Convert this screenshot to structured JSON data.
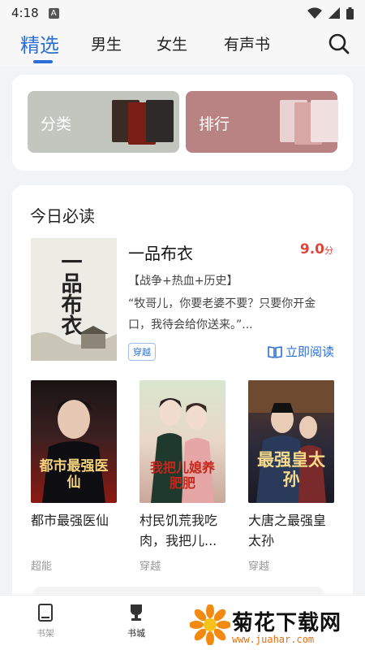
{
  "status": {
    "time": "4:18",
    "indicator": "A"
  },
  "tabs": [
    {
      "label": "精选",
      "active": true
    },
    {
      "label": "男生"
    },
    {
      "label": "女生"
    },
    {
      "label": "有声书"
    }
  ],
  "search_icon": "search-icon",
  "banners": [
    {
      "label": "分类",
      "color": "#c3c6bf"
    },
    {
      "label": "排行",
      "color": "#b88382"
    }
  ],
  "section": {
    "title": "今日必读"
  },
  "featured": {
    "title": "一品布衣",
    "score": "9.0",
    "score_unit": "分",
    "tags": "【战争+热血+历史】",
    "desc": "“牧哥儿，你要老婆不要？只要你开金口，我待会给你送来。”...",
    "badge": "穿越",
    "read_label": "立即阅读",
    "cover_text": "一品布衣"
  },
  "books": [
    {
      "title": "都市最强医仙",
      "tag": "超能",
      "cover_text": "都市最强医仙"
    },
    {
      "title": "村民饥荒我吃肉，我把儿...",
      "tag": "穿越",
      "cover_text": "我把儿媳养肥肥"
    },
    {
      "title": "大唐之最强皇太孙",
      "tag": "穿越",
      "cover_text": "最强皇太孙"
    }
  ],
  "bottom_nav": [
    {
      "label": "书架",
      "icon": "bookshelf-icon"
    },
    {
      "label": "书城",
      "icon": "trophy-icon",
      "active": true
    }
  ],
  "watermark": {
    "title": "菊花下载网",
    "url": "www.juahar.com"
  }
}
